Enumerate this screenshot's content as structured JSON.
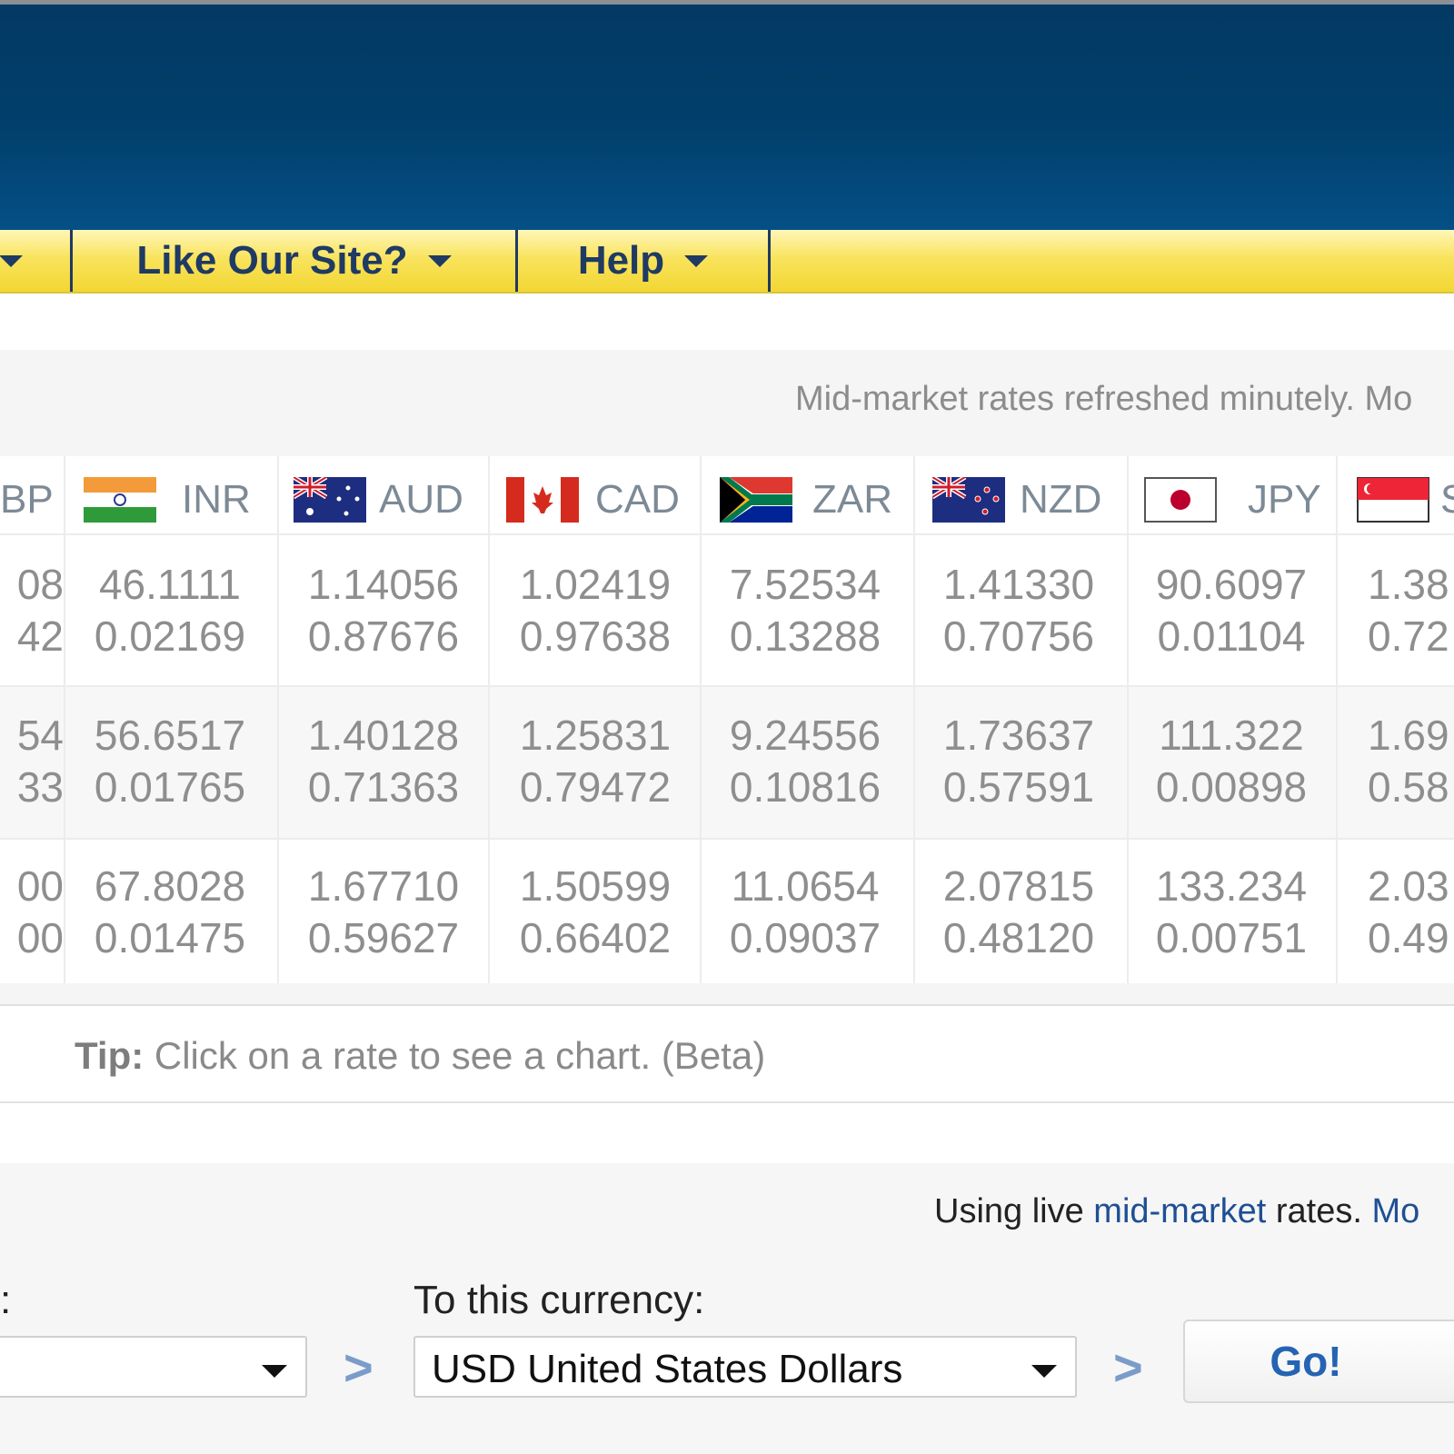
{
  "nav": {
    "items": [
      {
        "label": ""
      },
      {
        "label": "Like Our Site?"
      },
      {
        "label": "Help"
      }
    ]
  },
  "rates": {
    "refreshed_text": "Mid-market rates refreshed minutely. Mo",
    "columns": [
      {
        "code": "BP",
        "flag": "gbp-flag-icon"
      },
      {
        "code": "INR",
        "flag": "india-flag-icon"
      },
      {
        "code": "AUD",
        "flag": "australia-flag-icon"
      },
      {
        "code": "CAD",
        "flag": "canada-flag-icon"
      },
      {
        "code": "ZAR",
        "flag": "south-africa-flag-icon"
      },
      {
        "code": "NZD",
        "flag": "new-zealand-flag-icon"
      },
      {
        "code": "JPY",
        "flag": "japan-flag-icon"
      },
      {
        "code": "S",
        "flag": "singapore-flag-icon"
      }
    ],
    "rows": [
      [
        {
          "top": "08",
          "bottom": "42"
        },
        {
          "top": "46.1111",
          "bottom": "0.02169"
        },
        {
          "top": "1.14056",
          "bottom": "0.87676"
        },
        {
          "top": "1.02419",
          "bottom": "0.97638"
        },
        {
          "top": "7.52534",
          "bottom": "0.13288"
        },
        {
          "top": "1.41330",
          "bottom": "0.70756"
        },
        {
          "top": "90.6097",
          "bottom": "0.01104"
        },
        {
          "top": "1.38",
          "bottom": "0.72"
        }
      ],
      [
        {
          "top": "54",
          "bottom": "33"
        },
        {
          "top": "56.6517",
          "bottom": "0.01765"
        },
        {
          "top": "1.40128",
          "bottom": "0.71363"
        },
        {
          "top": "1.25831",
          "bottom": "0.79472"
        },
        {
          "top": "9.24556",
          "bottom": "0.10816"
        },
        {
          "top": "1.73637",
          "bottom": "0.57591"
        },
        {
          "top": "111.322",
          "bottom": "0.00898"
        },
        {
          "top": "1.69",
          "bottom": "0.58"
        }
      ],
      [
        {
          "top": "00",
          "bottom": "00"
        },
        {
          "top": "67.8028",
          "bottom": "0.01475"
        },
        {
          "top": "1.67710",
          "bottom": "0.59627"
        },
        {
          "top": "1.50599",
          "bottom": "0.66402"
        },
        {
          "top": "11.0654",
          "bottom": "0.09037"
        },
        {
          "top": "2.07815",
          "bottom": "0.48120"
        },
        {
          "top": "133.234",
          "bottom": "0.00751"
        },
        {
          "top": "2.03",
          "bottom": "0.49"
        }
      ]
    ],
    "tip_label": "Tip:",
    "tip_text": " Click on a rate to see a chart. (Beta)"
  },
  "converter": {
    "live_prefix": "Using live ",
    "live_link": "mid-market",
    "live_suffix": " rates. ",
    "more_link": "Mo",
    "from_label": ":",
    "from_value": "",
    "to_label": "To this currency:",
    "to_value": "USD United States Dollars",
    "arrow_glyph": ">",
    "go_label": "Go!"
  },
  "colors": {
    "header": "#023f6c",
    "nav_yellow": "#f9e35e",
    "nav_text": "#1f3a63",
    "link_blue": "#1f4f94"
  }
}
